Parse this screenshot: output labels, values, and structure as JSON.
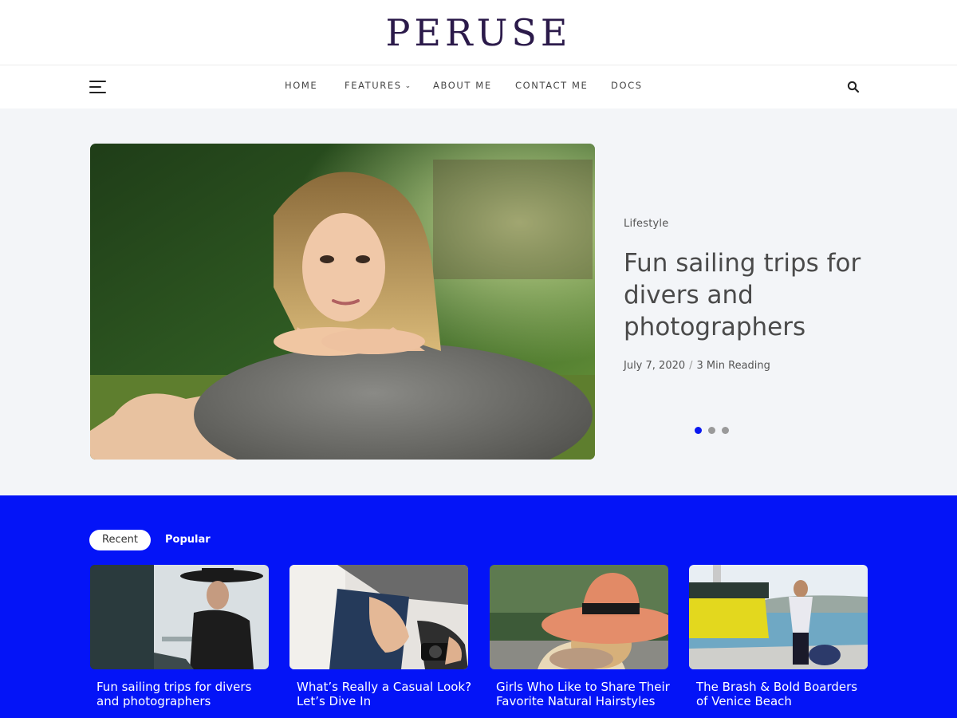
{
  "site": {
    "logo": "PERUSE"
  },
  "nav": {
    "items": [
      {
        "label": "HOME",
        "has_dropdown": false
      },
      {
        "label": "FEATURES",
        "has_dropdown": true
      },
      {
        "label": "ABOUT ME",
        "has_dropdown": false
      },
      {
        "label": "CONTACT ME",
        "has_dropdown": false
      },
      {
        "label": "DOCS",
        "has_dropdown": false
      }
    ],
    "menu_icon": "hamburger-icon",
    "search_icon": "search-icon",
    "dropdown_icon": "chevron-down-icon"
  },
  "hero": {
    "category": "Lifestyle",
    "title": "Fun sailing trips for divers and photographers",
    "date": "July 7, 2020",
    "separator": "/",
    "reading_time": "3 Min Reading",
    "slides": 3,
    "active_slide": 1
  },
  "recent": {
    "tabs": [
      {
        "label": "Recent",
        "active": true
      },
      {
        "label": "Popular",
        "active": false
      }
    ],
    "posts": [
      {
        "title": "Fun sailing trips for divers and photographers"
      },
      {
        "title": "What’s Really a Casual Look? Let’s Dive In"
      },
      {
        "title": "Girls Who Like to Share Their Favorite Natural Hairstyles"
      },
      {
        "title": "The Brash & Bold Boarders of Venice Beach"
      }
    ]
  },
  "colors": {
    "accent_blue": "#0414f7",
    "active_dot": "#0a18f0",
    "logo": "#2b1a4a",
    "hero_bg": "#f3f5f8"
  }
}
